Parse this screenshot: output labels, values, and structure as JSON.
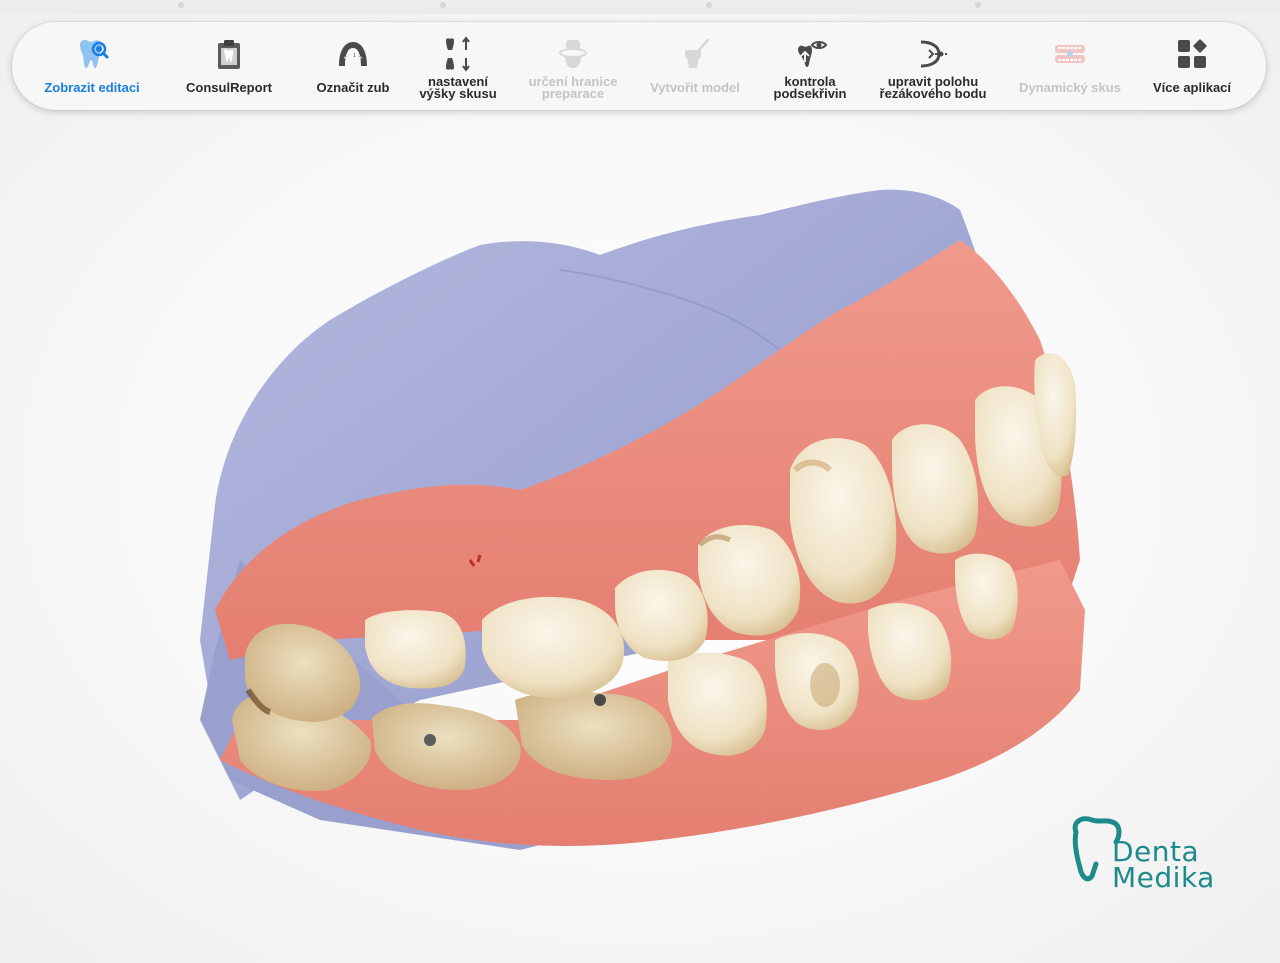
{
  "toolbar": {
    "items": [
      {
        "label": "Zobrazit editaci",
        "state": "active",
        "icon": "tooth-magnify-icon"
      },
      {
        "label": "ConsulReport",
        "state": "enabled",
        "icon": "report-clipboard-icon"
      },
      {
        "label": "Označit zub",
        "state": "enabled",
        "icon": "dental-arch-icon"
      },
      {
        "label": "nastavení výšky skusu",
        "label_lines": [
          "nastavení",
          "výšky skusu"
        ],
        "state": "enabled",
        "icon": "bite-height-icon"
      },
      {
        "label": "určení hranice preparace",
        "label_lines": [
          "určení hranice",
          "preparace"
        ],
        "state": "disabled",
        "icon": "margin-line-icon"
      },
      {
        "label": "Vytvořit model",
        "state": "disabled",
        "icon": "create-model-icon"
      },
      {
        "label": "kontrola podsekřivin",
        "label_lines": [
          "kontrola",
          "podsekřivin"
        ],
        "state": "enabled",
        "icon": "undercut-check-icon"
      },
      {
        "label": "upravit polohu řezákového bodu",
        "label_lines": [
          "upravit polohu",
          "řezákového bodu"
        ],
        "state": "enabled",
        "icon": "incisal-point-icon"
      },
      {
        "label": "Dynamický skus",
        "state": "disabled",
        "icon": "dynamic-bite-icon"
      },
      {
        "label": "Více aplikací",
        "state": "enabled",
        "icon": "more-apps-icon"
      }
    ]
  },
  "logo": {
    "line1": "Denta",
    "line2": "Medika",
    "color": "#1e8a8c"
  },
  "colors": {
    "accent": "#1a7fe0",
    "text": "#2b2b2b",
    "disabled": "#c4c4c4",
    "model_base": "#a3a9d4",
    "gum": "#e8897a"
  }
}
